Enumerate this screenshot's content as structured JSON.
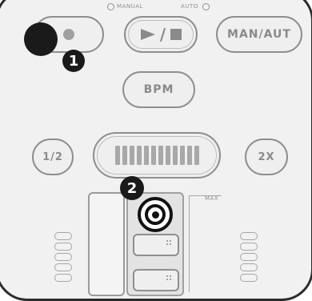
{
  "labels": {
    "manual": "MANUAL",
    "auto": "AUTO",
    "max": "MAX"
  },
  "buttons": {
    "record": "●",
    "play_stop": "►/■",
    "man_aut": "MAN/AUT",
    "bpm": "BPM",
    "half": "1/2",
    "double": "2X"
  },
  "callouts": {
    "one": "1",
    "two": "2"
  },
  "icons": {
    "record": "record-dot-icon",
    "play_stop": "play-stop-icon",
    "target": "target-ring-icon",
    "grip": "grip-dots-icon"
  }
}
